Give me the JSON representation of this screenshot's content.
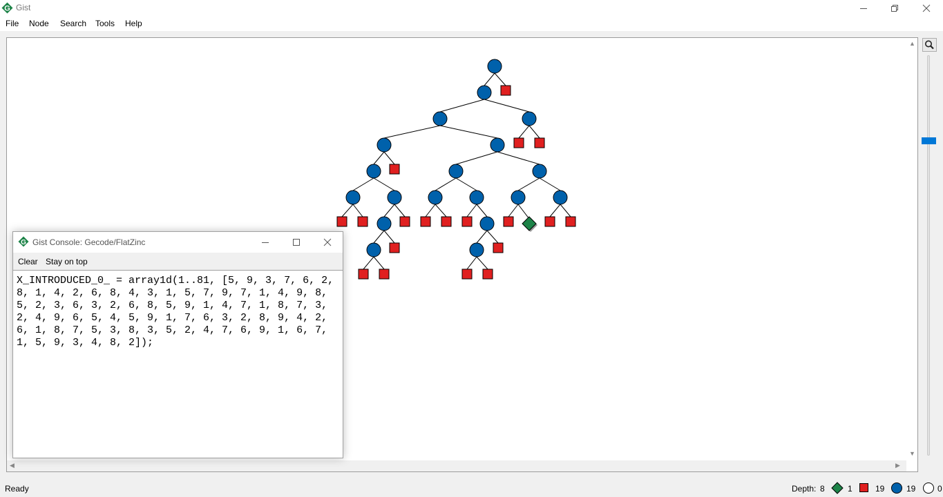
{
  "window": {
    "title": "Gist",
    "controls": {
      "minimize": "minimize-icon",
      "maximize": "restore-icon",
      "close": "close-icon"
    }
  },
  "menu": {
    "items": [
      "File",
      "Node",
      "Search",
      "Tools",
      "Help"
    ]
  },
  "tree": {
    "colors": {
      "choice_node": "#0061ab",
      "failed_node": "#e02020",
      "solution_node": "#1d8348",
      "edge": "#000000"
    }
  },
  "console": {
    "title": "Gist Console: Gecode/FlatZinc",
    "toolbar": {
      "clear": "Clear",
      "stay_on_top": "Stay on top"
    },
    "output": "X_INTRODUCED_0_ = array1d(1..81, [5, 9, 3, 7, 6, 2, 8, 1, 4, 2, 6, 8, 4, 3, 1, 5, 7, 9, 7, 1, 4, 9, 8, 5, 2, 3, 6, 3, 2, 6, 8, 5, 9, 1, 4, 7, 1, 8, 7, 3, 2, 4, 9, 6, 5, 4, 5, 9, 1, 7, 6, 3, 2, 8, 9, 4, 2, 6, 1, 8, 7, 5, 3, 8, 3, 5, 2, 4, 7, 6, 9, 1, 6, 7, 1, 5, 9, 3, 4, 8, 2]);"
  },
  "zoom": {
    "icon": "magnifier-icon",
    "level_fraction": 0.79
  },
  "status": {
    "ready": "Ready",
    "depth_label": "Depth:",
    "depth": "8",
    "solutions": "1",
    "failures": "19",
    "choices": "19",
    "open": "0"
  }
}
